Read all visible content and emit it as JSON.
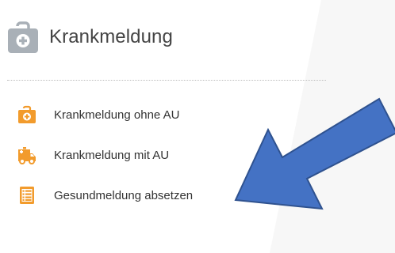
{
  "header": {
    "title": "Krankmeldung",
    "icon": "medical-case-icon"
  },
  "menu": {
    "items": [
      {
        "label": "Krankmeldung ohne AU",
        "icon": "medical-case-icon"
      },
      {
        "label": "Krankmeldung mit AU",
        "icon": "ambulance-icon"
      },
      {
        "label": "Gesundmeldung absetzen",
        "icon": "document-list-icon"
      }
    ]
  },
  "annotation": {
    "icon": "pointer-arrow-icon"
  },
  "colors": {
    "header_icon": "#a9b0b7",
    "menu_icon": "#f29b2c",
    "arrow_fill": "#4472c4",
    "arrow_stroke": "#2f528f",
    "text": "#333333",
    "divider": "#bdbdbd"
  }
}
